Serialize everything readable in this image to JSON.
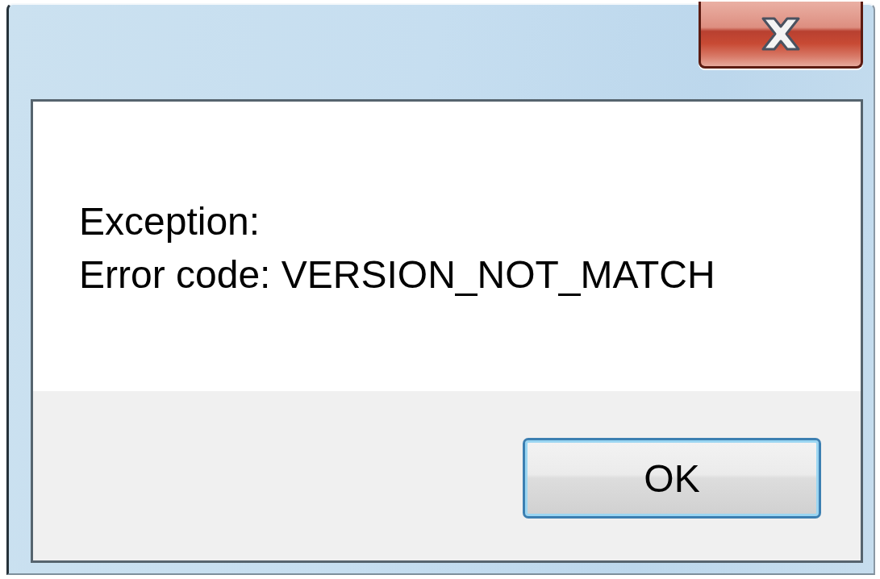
{
  "dialog": {
    "message": [
      "Exception:",
      "Error code: VERSION_NOT_MATCH"
    ],
    "buttons": [
      {
        "label": "OK",
        "default": true
      }
    ]
  }
}
